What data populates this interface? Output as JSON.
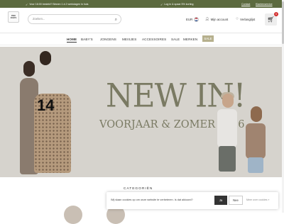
{
  "topbar": {
    "usps": [
      "Voor 16:00 besteld? Binnen 1 à 2 werkdagen in huis",
      "Log in & spaar 5% korting"
    ],
    "links": [
      "Contact",
      "Klantenservice"
    ]
  },
  "header": {
    "logo_text": "PINK PANTS",
    "search_placeholder": "Zoeken...",
    "currency": "EUR",
    "account_label": "Mijn account",
    "wishlist_label": "Verlanglijst",
    "cart_count": "0"
  },
  "nav": {
    "items": [
      "HOME",
      "BABY'S",
      "JONGENS",
      "MEISJES",
      "ACCESSOIRES",
      "SALE",
      "MERKEN"
    ],
    "sale_button": "SALE"
  },
  "hero": {
    "title": "NEW IN!",
    "subtitle": "VOORJAAR & ZOMER 2026",
    "shirt_number": "14"
  },
  "categories": {
    "title": "CATEGORIËN"
  },
  "cookie": {
    "text": "Wij slaan cookies op om onze website te verbeteren. Is dat akkoord?",
    "accept": "Ja",
    "decline": "Nee",
    "more": "Meer over cookies »"
  },
  "colors": {
    "topbar": "#5c6a3f",
    "hero_text": "#7a7a63",
    "sale_button": "#b6b08d"
  }
}
